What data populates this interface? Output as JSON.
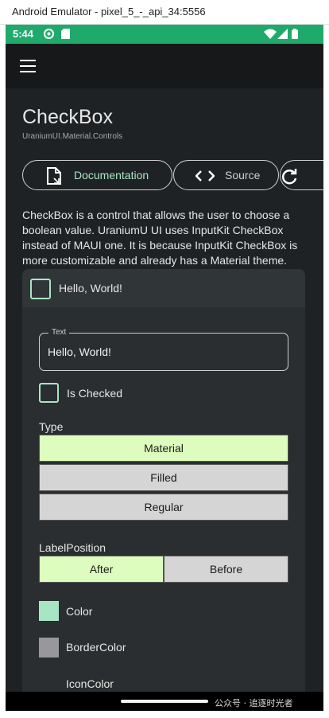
{
  "window": {
    "title": "Android Emulator - pixel_5_-_api_34:5556"
  },
  "statusbar": {
    "time": "5:44"
  },
  "page": {
    "title": "CheckBox",
    "subtitle": "UraniumUI.Material.Controls"
  },
  "tabs": [
    {
      "label": "Documentation",
      "icon": "document-icon"
    },
    {
      "label": "Source",
      "icon": "code-icon"
    },
    {
      "label": "",
      "icon": "refresh-icon"
    }
  ],
  "description": "CheckBox is a control that allows the user to choose a boolean value. UraniumU UI uses InputKit CheckBox instead of MAUI one. It is because InputKit CheckBox is more customizable and already has a Material theme.",
  "demo": {
    "checkbox_label": "Hello, World!",
    "text_field": {
      "label": "Text",
      "value": "Hello, World!"
    },
    "is_checked_label": "Is Checked",
    "type": {
      "label": "Type",
      "options": [
        "Material",
        "Filled",
        "Regular"
      ],
      "selected": "Material"
    },
    "label_position": {
      "label": "LabelPosition",
      "options": [
        "After",
        "Before"
      ],
      "selected": "After"
    },
    "color": {
      "label": "Color",
      "value": "#a7e6c3"
    },
    "border_color": {
      "label": "BorderColor",
      "value": "#98979c"
    },
    "icon_color": {
      "label": "IconColor"
    }
  },
  "watermark": "公众号 · 追逐时光者",
  "colors": {
    "accent": "#1faa6c",
    "selected": "#ddfdbe",
    "unselected": "#d5d5d5",
    "background": "#1f2224"
  }
}
